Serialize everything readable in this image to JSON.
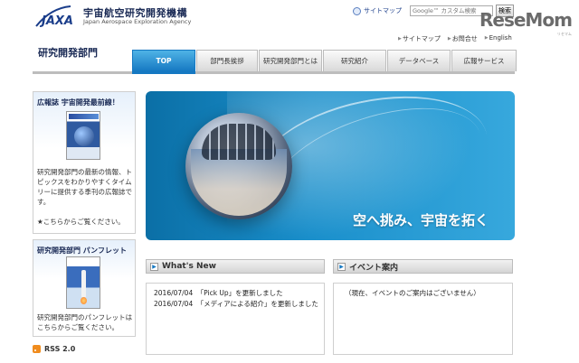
{
  "header": {
    "logo_text": "JAXA",
    "org_name": "宇宙航空研究開発機構",
    "org_name_en": "Japan Aerospace Exploration Agency",
    "sitemap_label": "サイトマップ",
    "search_placeholder": "Google™ カスタム検索",
    "search_button": "検索",
    "watermark": "ReseMom",
    "watermark_sub": "リセマム"
  },
  "util_links": [
    "サイトマップ",
    "お問合せ",
    "English"
  ],
  "section_title": "研究開発部門",
  "nav": {
    "tabs": [
      {
        "label": "TOP",
        "active": true
      },
      {
        "label": "部門長挨拶",
        "active": false
      },
      {
        "label": "研究開発部門とは",
        "active": false
      },
      {
        "label": "研究紹介",
        "active": false
      },
      {
        "label": "データベース",
        "active": false
      },
      {
        "label": "広報サービス",
        "active": false
      }
    ]
  },
  "sidebar": {
    "magazine": {
      "heading": "広報誌 宇宙開発最前線！",
      "description": "研究開発部門の最新の情報、トピックスをわかりやすくタイムリーに提供する季刊の広報誌です。",
      "more": "★こちらからご覧ください。"
    },
    "pamphlet": {
      "heading": "研究開発部門 パンフレット",
      "description": "研究開発部門のパンフレットはこちらからご覧ください。"
    },
    "rss_label": "RSS 2.0"
  },
  "hero": {
    "caption": "空へ挑み、宇宙を拓く"
  },
  "news": {
    "heading": "What's New",
    "items": [
      {
        "date": "2016/07/04",
        "text": "「Pick Up」を更新しました"
      },
      {
        "date": "2016/07/04",
        "text": "「メディアによる紹介」を更新しました"
      }
    ]
  },
  "events": {
    "heading": "イベント案内",
    "empty_text": "（現在、イベントのご案内はございません）"
  },
  "colors": {
    "accent": "#1578c2",
    "navy": "#1a2a55",
    "hero_bg": "#1a8fcb"
  }
}
